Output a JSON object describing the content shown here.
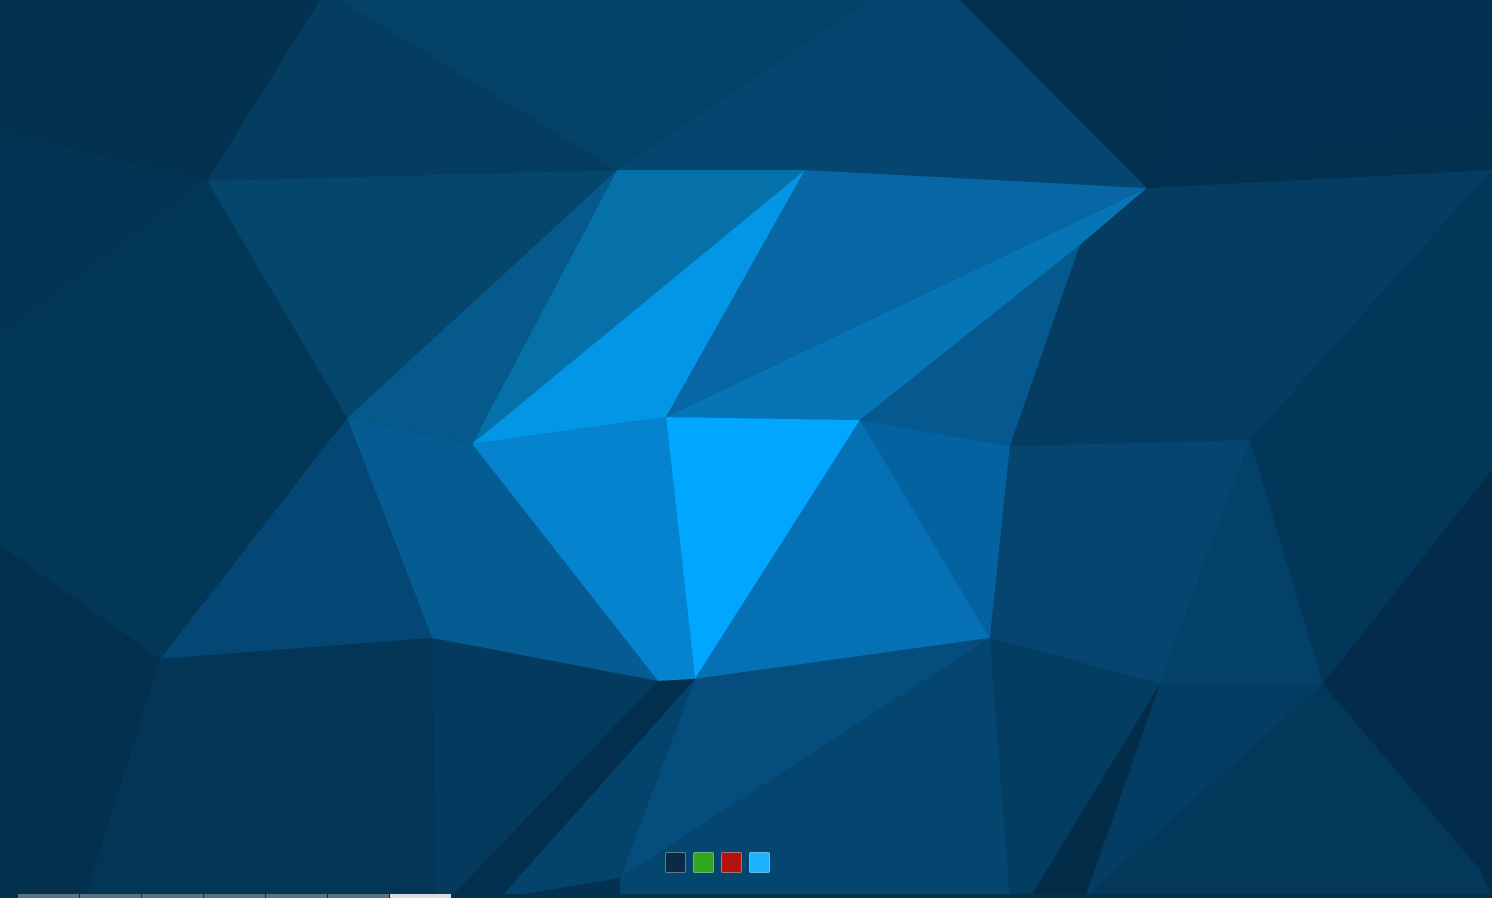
{
  "desktop": {
    "wallpaper": {
      "icon": "lowpoly-wallpaper",
      "base_color": "#033152",
      "highlight_color": "#00a6ff"
    },
    "color_swatches": [
      {
        "name": "swatch-navy",
        "color": "#0b2b45"
      },
      {
        "name": "swatch-green",
        "color": "#2fa61b"
      },
      {
        "name": "swatch-red",
        "color": "#b5120e"
      },
      {
        "name": "swatch-sky",
        "color": "#1fb2ff"
      }
    ],
    "bottom_bar": {
      "tabs": [
        {
          "active": false
        },
        {
          "active": false
        },
        {
          "active": false
        },
        {
          "active": false
        },
        {
          "active": false
        },
        {
          "active": false
        },
        {
          "active": true
        }
      ]
    }
  }
}
